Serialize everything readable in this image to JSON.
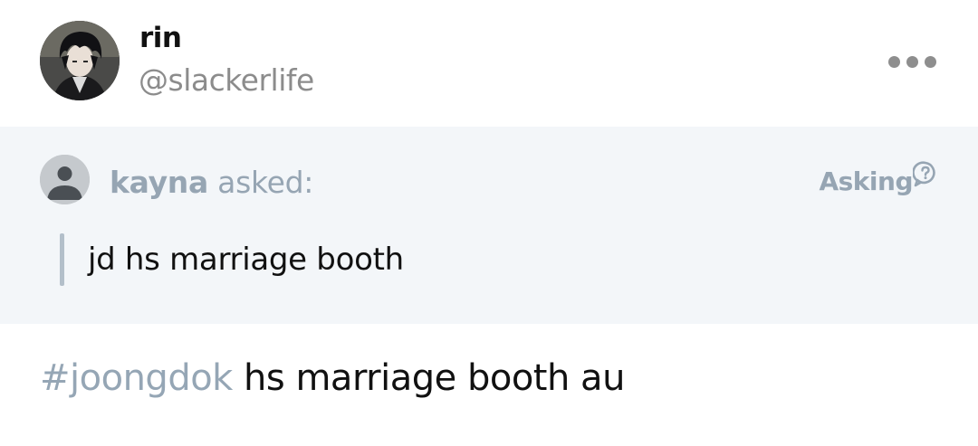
{
  "header": {
    "display_name": "rin",
    "handle": "@slackerlife",
    "avatar_icon": "user-photo-icon",
    "more_icon": "more-dots-icon"
  },
  "ask": {
    "asker_name": "kayna",
    "asked_suffix": " asked:",
    "asker_avatar_icon": "anonymous-user-icon",
    "badge_label": "Asking",
    "badge_icon": "question-speech-bubble-icon",
    "question": "jd hs marriage booth"
  },
  "post": {
    "hashtag": "#joongdok",
    "text": " hs marriage booth au"
  },
  "colors": {
    "accent_gray_blue": "#96a5b3",
    "ask_background": "#f3f6f9",
    "text": "#111111",
    "handle": "#8c8c8c"
  }
}
